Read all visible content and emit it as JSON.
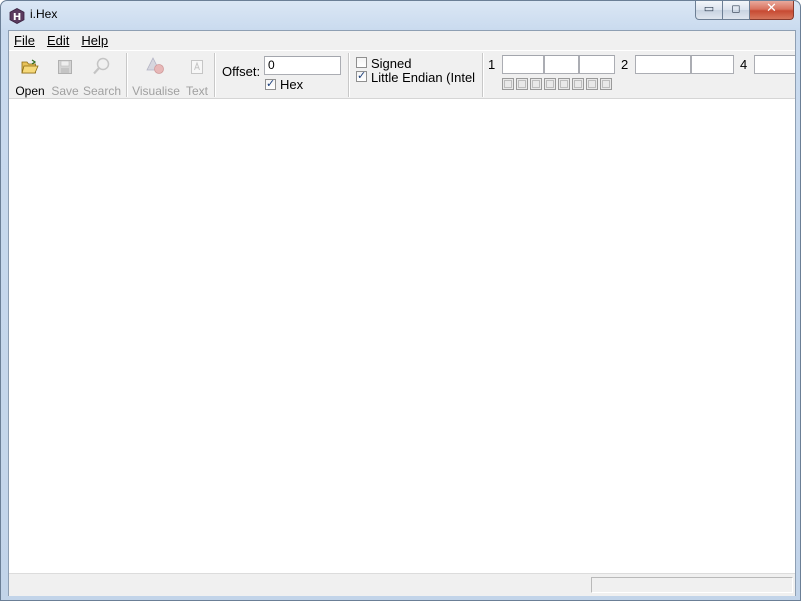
{
  "window": {
    "title": "i.Hex",
    "app_icon_letter": "H",
    "buttons": {
      "minimize": "▭",
      "maximize": "◻",
      "close": "✕"
    }
  },
  "menu": [
    {
      "label": "File"
    },
    {
      "label": "Edit"
    },
    {
      "label": "Help"
    }
  ],
  "toolbar": {
    "open_label": "Open",
    "save_label": "Save",
    "search_label": "Search",
    "visualise_label": "Visualise",
    "text_label": "Text",
    "offset_label": "Offset:",
    "offset_value": "0",
    "hex_label": "Hex",
    "hex_checked": true,
    "signed_label": "Signed",
    "signed_checked": false,
    "little_endian_label": "Little Endian (Intel",
    "little_endian_checked": true,
    "size1_label": "1",
    "size2_label": "2",
    "size4_label": "4",
    "size1_values": [
      "",
      "",
      ""
    ],
    "size2_values": [
      "",
      ""
    ],
    "size4_values": [
      ""
    ]
  },
  "status": {
    "text": ""
  },
  "colors": {
    "frame": "#c2d4e9",
    "close": "#c74a33",
    "accent": "#1c3f7a"
  }
}
